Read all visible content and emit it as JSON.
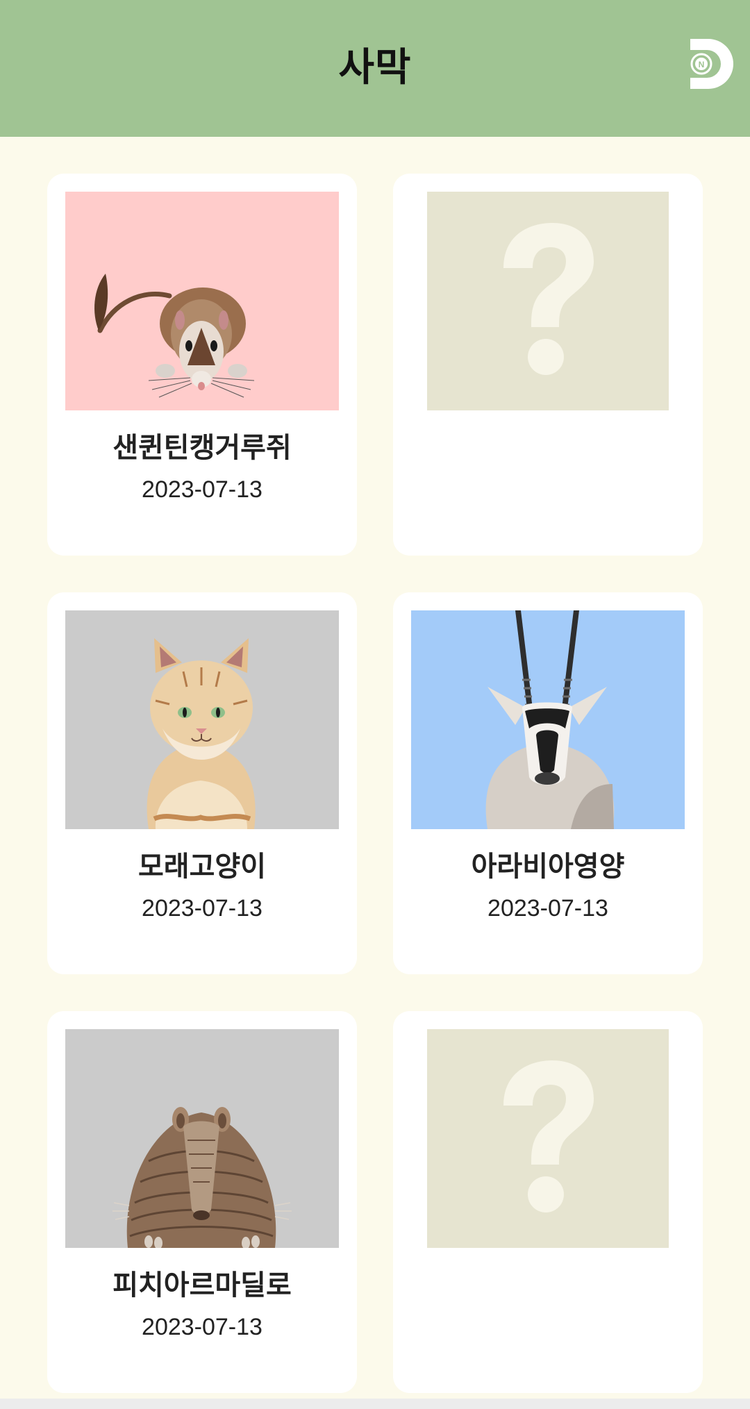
{
  "header": {
    "title": "사막",
    "logo_icon": "d-logo-icon"
  },
  "colors": {
    "header_bg": "#a0c493",
    "page_bg": "#fcfaeb",
    "card_bg": "#ffffff",
    "locked_thumb_bg": "#e6e4d0"
  },
  "cards": [
    {
      "name": "샌퀸틴캥거루쥐",
      "date": "2023-07-13",
      "locked": false,
      "image": "kangaroo-rat",
      "bg": "#ffcccb"
    },
    {
      "name": "",
      "date": "",
      "locked": true,
      "image": "question-mark"
    },
    {
      "name": "모래고양이",
      "date": "2023-07-13",
      "locked": false,
      "image": "sand-cat",
      "bg": "#cbcbcb"
    },
    {
      "name": "아라비아영양",
      "date": "2023-07-13",
      "locked": false,
      "image": "arabian-oryx",
      "bg": "#a3cbf9"
    },
    {
      "name": "피치아르마딜로",
      "date": "2023-07-13",
      "locked": false,
      "image": "pichi-armadillo",
      "bg": "#cbcbcb"
    },
    {
      "name": "",
      "date": "",
      "locked": true,
      "image": "question-mark"
    }
  ]
}
